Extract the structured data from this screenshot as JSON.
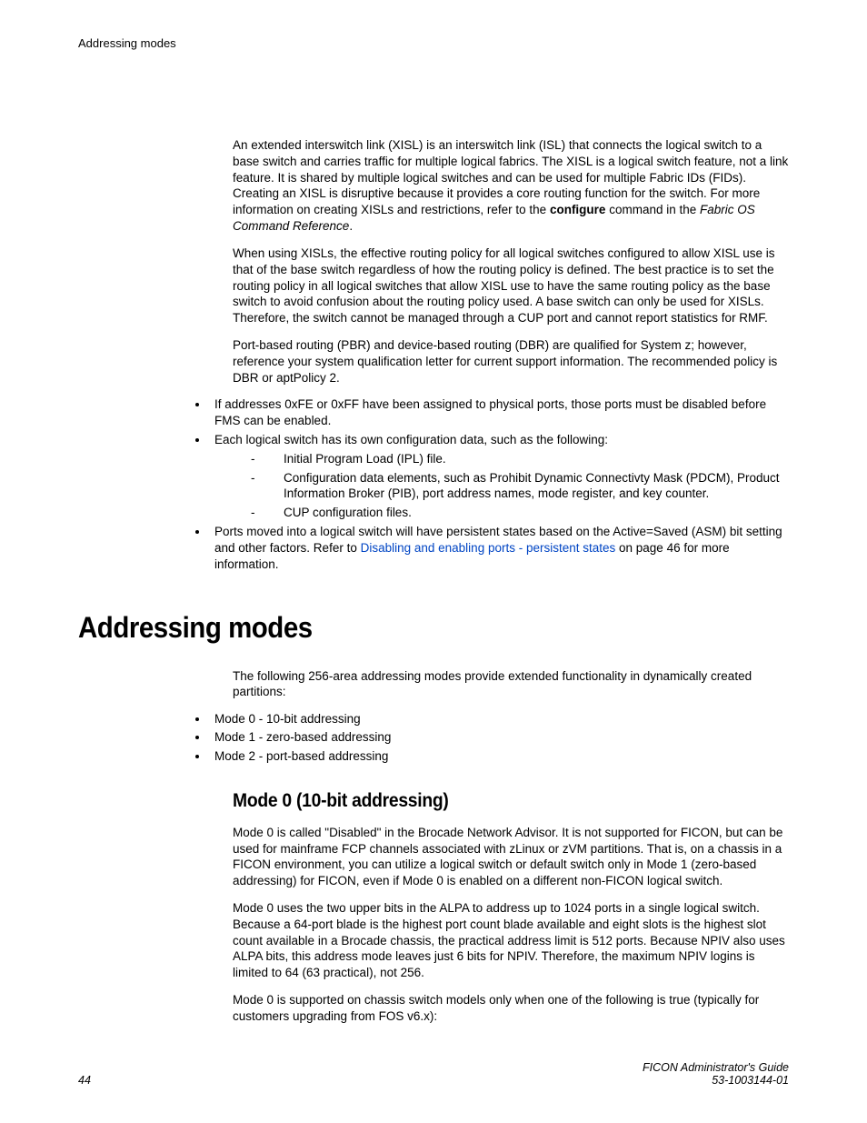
{
  "header": {
    "running_title": "Addressing modes"
  },
  "body": {
    "p1_a": "An extended interswitch link (XISL) is an interswitch link (ISL) that connects the logical switch to a base switch and carries traffic for multiple logical fabrics. The XISL is a logical switch feature, not a link feature. It is shared by multiple logical switches and can be used for multiple Fabric IDs (FIDs). Creating an XISL is disruptive because it provides a core routing function for the switch. For more information on creating XISLs and restrictions, refer to the ",
    "p1_bold": "configure",
    "p1_b": " command in the ",
    "p1_italic": "Fabric OS Command Reference",
    "p1_c": ".",
    "p2": "When using XISLs, the effective routing policy for all logical switches configured to allow XISL use is that of the base switch regardless of how the routing policy is defined. The best practice is to set the routing policy in all logical switches that allow XISL use to have the same routing policy as the base switch to avoid confusion about the routing policy used. A base switch can only be used for XISLs. Therefore, the switch cannot be managed through a CUP port and cannot report statistics for RMF.",
    "p3": "Port-based routing (PBR) and device-based routing (DBR) are qualified for System z; however, reference your system qualification letter for current support information. The recommended policy is DBR or aptPolicy 2.",
    "bullets1": {
      "b1": "If addresses 0xFE or 0xFF have been assigned to physical ports, those ports must be disabled before FMS can be enabled.",
      "b2": "Each logical switch has its own configuration data, such as the following:",
      "b2_sub": {
        "d1": "Initial Program Load (IPL) file.",
        "d2": "Configuration data elements, such as Prohibit Dynamic Connectivty Mask (PDCM), Product Information Broker (PIB), port address names, mode register, and key counter.",
        "d3": "CUP configuration files."
      },
      "b3_a": "Ports moved into a logical switch will have persistent states based on the Active=Saved (ASM) bit setting and other factors. Refer to ",
      "b3_link": "Disabling and enabling ports - persistent states",
      "b3_b": " on page 46 for more information."
    }
  },
  "section": {
    "title": "Addressing modes",
    "intro": "The following 256-area addressing modes provide extended functionality in dynamically created partitions:",
    "modes": {
      "m0": "Mode 0 - 10-bit addressing",
      "m1": "Mode 1 - zero-based addressing",
      "m2": "Mode 2 - port-based addressing"
    },
    "sub_title": "Mode 0 (10-bit addressing)",
    "sp1": "Mode 0 is called \"Disabled\" in the Brocade Network Advisor. It is not supported for FICON, but can be used for mainframe FCP channels associated with zLinux or zVM partitions. That is, on a chassis in a FICON environment, you can utilize a logical switch or default switch only in Mode 1 (zero-based addressing) for FICON, even if Mode 0 is enabled on a different non-FICON logical switch.",
    "sp2": "Mode 0 uses the two upper bits in the ALPA to address up to 1024 ports in a single logical switch. Because a 64-port blade is the highest port count blade available and eight slots is the highest slot count available in a Brocade chassis, the practical address limit is 512 ports. Because NPIV also uses ALPA bits, this address mode leaves just 6 bits for NPIV. Therefore, the maximum NPIV logins is limited to 64 (63 practical), not 256.",
    "sp3": "Mode 0 is supported on chassis switch models only when one of the following is true (typically for customers upgrading from FOS v6.x):"
  },
  "footer": {
    "page": "44",
    "guide": "FICON Administrator's Guide",
    "docnum": "53-1003144-01"
  }
}
